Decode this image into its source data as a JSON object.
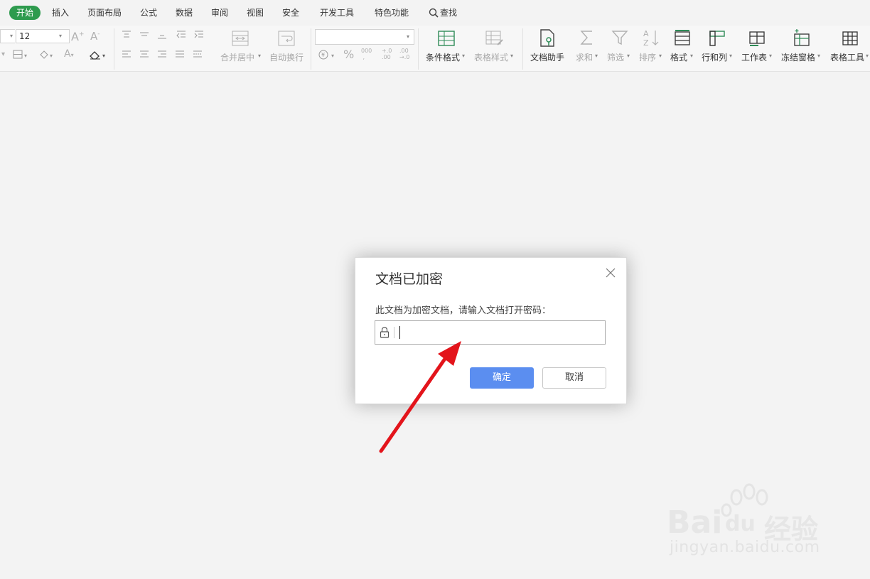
{
  "menu": {
    "tabs": [
      "开始",
      "插入",
      "页面布局",
      "公式",
      "数据",
      "审阅",
      "视图",
      "安全",
      "开发工具",
      "特色功能"
    ],
    "search_label": "查找"
  },
  "ribbon": {
    "font_size": "12",
    "merge_center": "合并居中",
    "wrap_text": "自动换行",
    "number_format": "",
    "conditional_format": "条件格式",
    "table_style": "表格样式",
    "doc_assistant": "文档助手",
    "sum": "求和",
    "filter": "筛选",
    "sort": "排序",
    "format": "格式",
    "row_col": "行和列",
    "worksheet": "工作表",
    "freeze": "冻结窗格",
    "table_tools": "表格工具",
    "pct": "%",
    "thousand": "000",
    "inc_dec": "+.0 .00",
    "dec_dec": ".00 →.0"
  },
  "dialog": {
    "title": "文档已加密",
    "prompt": "此文档为加密文档，请输入文档打开密码：",
    "password_value": "",
    "ok_label": "确定",
    "cancel_label": "取消"
  },
  "watermark": {
    "brand": "Bai",
    "brand2": "du",
    "product": "经验",
    "url": "jingyan.baidu.com"
  },
  "colors": {
    "accent_green": "#2e9b4e",
    "primary_button": "#5b8ef0",
    "annotation_arrow": "#e3141b"
  }
}
